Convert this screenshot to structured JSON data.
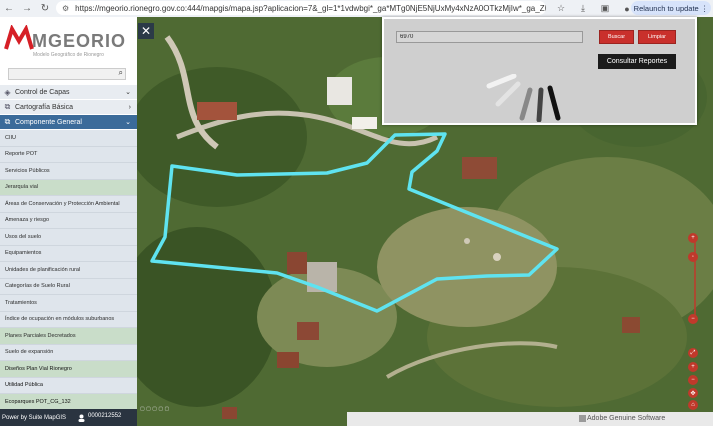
{
  "browser": {
    "url": "https://mgeorio.rionegro.gov.co:444/mapgis/mapa.jsp?aplicacion=7&_gl=1*1vdwbgi*_ga*MTg0NjE5NjUxMy4xNzA0OTkzMjIw*_ga_ZEL...",
    "relaunch_label": "Relaunch to update"
  },
  "logo": {
    "name": "MGEORIO",
    "subtitle": "Modelo Geográfico de Rionegro"
  },
  "sidebar": {
    "sections": [
      {
        "label": "Control de Capas"
      },
      {
        "label": "Cartografía Básica"
      },
      {
        "label": "Componente General"
      }
    ],
    "layers": [
      "CIIU",
      "Reporte POT",
      "Servicios Públicos",
      "Jerarquía vial",
      "Áreas de Conservación y Protección Ambiental",
      "Amenaza y riesgo",
      "Usos del suelo",
      "Equipamientos",
      "Unidades de planificación rural",
      "Categorías de Suelo Rural",
      "Tratamientos",
      "Índice de ocupación en módulos suburbanos",
      "Planes Parciales Decretados",
      "Suelo de expansión",
      "Diseños Plan Vial Rionegro",
      "Utilidad Pública",
      "Ecoparques POT_CG_132"
    ]
  },
  "statusbar": {
    "powered": "Power by Suite MapGIS",
    "user_id": "0000212552"
  },
  "panel": {
    "input_value": "6970",
    "search_label": "Buscar",
    "clear_label": "Limpiar",
    "reports_label": "Consultar Reportes"
  },
  "adobe_text": "Adobe Genuine Software",
  "colors": {
    "accent": "#3b6b9a",
    "red": "#c9302c",
    "parcel_outline": "#5fe3f0"
  }
}
